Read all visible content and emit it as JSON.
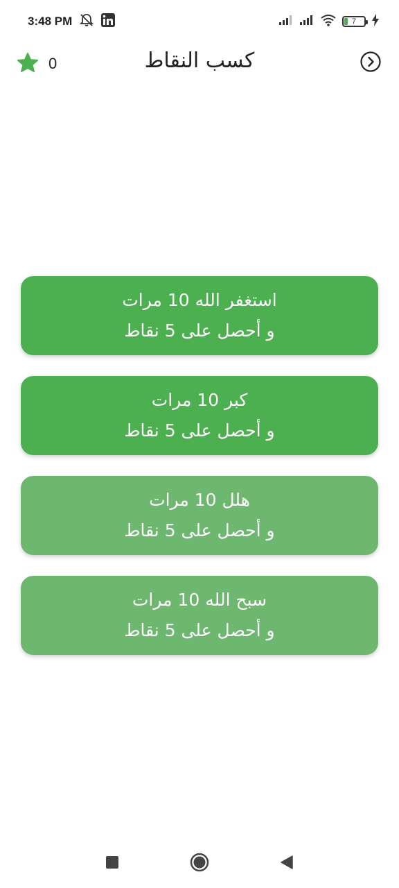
{
  "status_bar": {
    "time": "3:48 PM",
    "battery_level": "7",
    "icons": [
      "alarm-off-icon",
      "linkedin-icon",
      "signal-icon",
      "signal-icon",
      "wifi-icon",
      "battery-icon",
      "charging-icon"
    ]
  },
  "app_bar": {
    "title": "كسب النقاط",
    "points_value": "0",
    "points_icon": "star-icon",
    "forward_icon": "circle-chevron-right-icon"
  },
  "colors": {
    "accent": "#4caf50",
    "accent_light": "#6db76f"
  },
  "tasks": [
    {
      "line1": "استغفر الله 10 مرات",
      "line2": "و أحصل على 5 نقاط",
      "color": "#4caf50"
    },
    {
      "line1": "كبر 10 مرات",
      "line2": "و أحصل على 5 نقاط",
      "color": "#4caf50"
    },
    {
      "line1": "هلل 10 مرات",
      "line2": "و أحصل على 5 نقاط",
      "color": "#6db76f"
    },
    {
      "line1": "سبح الله 10 مرات",
      "line2": "و أحصل على 5 نقاط",
      "color": "#6db76f"
    }
  ],
  "nav_bar": {
    "icons": [
      "recents-square-icon",
      "home-circle-icon",
      "back-triangle-icon"
    ]
  }
}
